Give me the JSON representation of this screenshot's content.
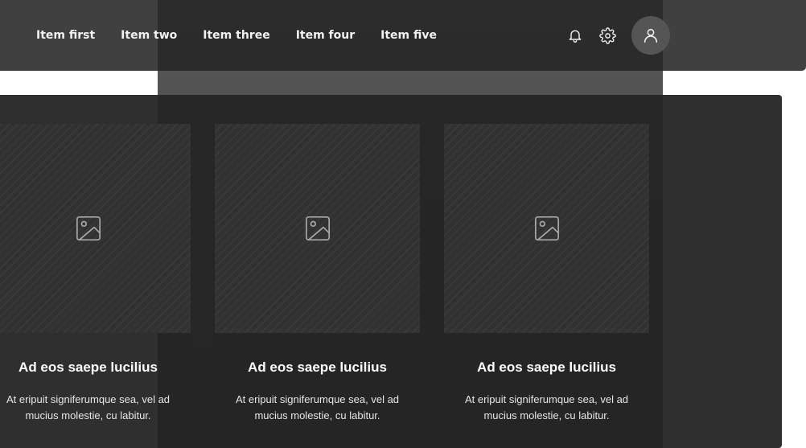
{
  "nav": {
    "items": [
      {
        "label": "Item first"
      },
      {
        "label": "Item two"
      },
      {
        "label": "Item three"
      },
      {
        "label": "Item four"
      },
      {
        "label": "Item five"
      }
    ],
    "actions": {
      "notifications_icon": "bell-icon",
      "settings_icon": "gear-icon",
      "profile_icon": "user-icon"
    }
  },
  "cards": [
    {
      "title": "Ad eos saepe lucilius",
      "text_line1": "At eripuit signiferumque sea, vel ad",
      "text_line2": "mucius molestie, cu labitur.",
      "image_icon": "image-placeholder-icon"
    },
    {
      "title": "Ad eos saepe lucilius",
      "text_line1": "At eripuit signiferumque sea, vel ad",
      "text_line2": "mucius molestie, cu labitur.",
      "image_icon": "image-placeholder-icon"
    },
    {
      "title": "Ad eos saepe lucilius",
      "text_line1": "At eripuit signiferumque sea, vel ad",
      "text_line2": "mucius molestie, cu labitur.",
      "image_icon": "image-placeholder-icon"
    }
  ],
  "colors": {
    "navbar": "#262626",
    "panel": "#242424",
    "avatar": "#555555",
    "text": "#ffffff"
  }
}
